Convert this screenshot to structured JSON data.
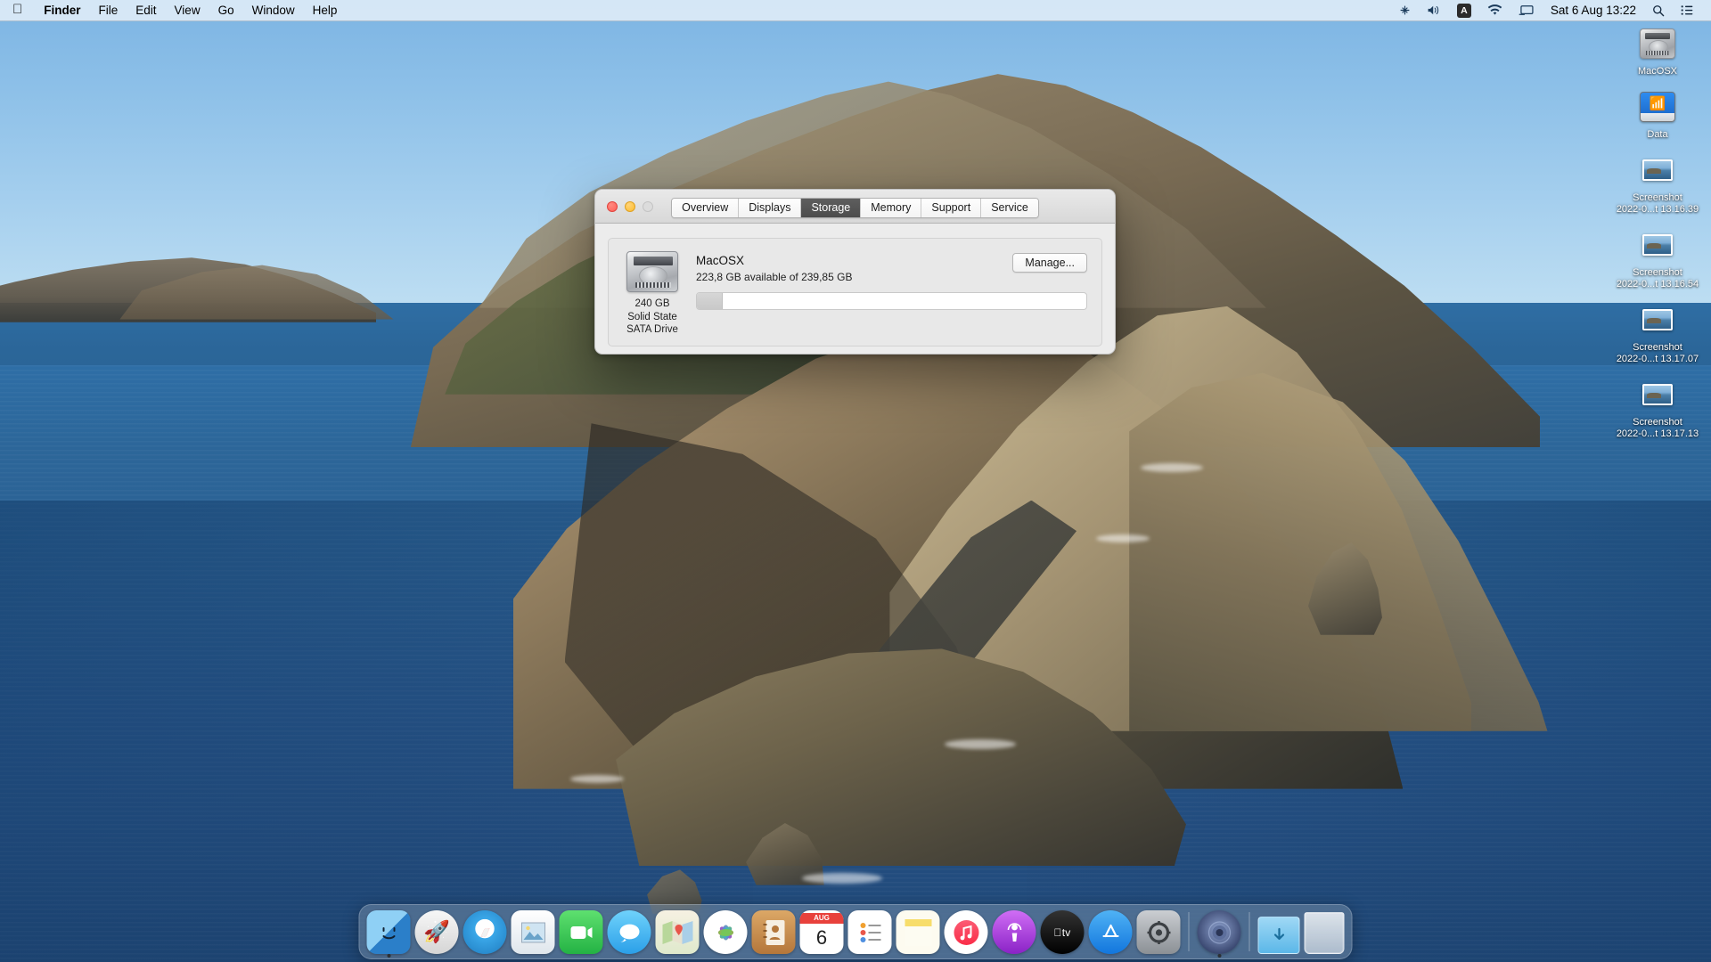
{
  "menubar": {
    "apple_icon": "apple-logo",
    "items": [
      {
        "label": "Finder",
        "bold": true
      },
      {
        "label": "File",
        "bold": false
      },
      {
        "label": "Edit",
        "bold": false
      },
      {
        "label": "View",
        "bold": false
      },
      {
        "label": "Go",
        "bold": false
      },
      {
        "label": "Window",
        "bold": false
      },
      {
        "label": "Help",
        "bold": false
      }
    ],
    "status_icons": [
      {
        "name": "bluetooth-transfer-icon",
        "glyph": "✳"
      },
      {
        "name": "volume-icon",
        "glyph": "🔊"
      },
      {
        "name": "input-source-icon",
        "glyph": "A"
      },
      {
        "name": "wifi-icon",
        "glyph": "wifi"
      },
      {
        "name": "screen-mirroring-icon",
        "glyph": "display"
      }
    ],
    "clock": "Sat 6 Aug 13:22",
    "spotlight_icon": "search-icon",
    "control_center_icon": "control-center-icon"
  },
  "desktop_icons": [
    {
      "name": "MacOSX",
      "type": "hard-drive"
    },
    {
      "name": "Data",
      "type": "network-disk"
    },
    {
      "name": "Screenshot\n2022-0...t 13.16.39",
      "line1": "Screenshot",
      "line2": "2022-0...t 13.16.39",
      "type": "screenshot-file"
    },
    {
      "name": "Screenshot\n2022-0...t 13.16.54",
      "line1": "Screenshot",
      "line2": "2022-0...t 13.16.54",
      "type": "screenshot-file"
    },
    {
      "name": "Screenshot\n2022-0...t 13.17.07",
      "line1": "Screenshot",
      "line2": "2022-0...t 13.17.07",
      "type": "screenshot-file"
    },
    {
      "name": "Screenshot\n2022-0...t 13.17.13",
      "line1": "Screenshot",
      "line2": "2022-0...t 13.17.13",
      "type": "screenshot-file"
    }
  ],
  "about_window": {
    "traffic_lights": {
      "close": "close",
      "minimize": "minimize",
      "zoom": "zoom-disabled"
    },
    "tabs": [
      {
        "label": "Overview",
        "active": false
      },
      {
        "label": "Displays",
        "active": false
      },
      {
        "label": "Storage",
        "active": true
      },
      {
        "label": "Memory",
        "active": false
      },
      {
        "label": "Support",
        "active": false
      },
      {
        "label": "Service",
        "active": false
      }
    ],
    "storage": {
      "volume_name": "MacOSX",
      "availability": "223,8 GB available of 239,85 GB",
      "manage_label": "Manage...",
      "drive_capacity": "240 GB",
      "drive_type_line1": "Solid State",
      "drive_type_line2": "SATA Drive",
      "used_percent": 6.7,
      "used_color": "#cfcfcf",
      "free_color": "#ffffff"
    }
  },
  "dock": {
    "items": [
      {
        "name": "finder",
        "label": "Finder",
        "glyph": "🙂",
        "bg": "linear-gradient(180deg,#4ea8e8,#2a7fc9)",
        "running": true
      },
      {
        "name": "launchpad",
        "label": "Launchpad",
        "glyph": "🚀",
        "bg": "linear-gradient(180deg,#f2f2f2,#d2d2d2)",
        "running": false
      },
      {
        "name": "safari",
        "label": "Safari",
        "glyph": "🧭",
        "bg": "linear-gradient(180deg,#f5fafd,#cfe6f5)",
        "running": false
      },
      {
        "name": "preview",
        "label": "Preview",
        "glyph": "🖼",
        "bg": "linear-gradient(180deg,#ffffff,#e3e8ee)",
        "running": false
      },
      {
        "name": "facetime",
        "label": "FaceTime",
        "glyph": "📹",
        "bg": "linear-gradient(180deg,#4cd964,#2ab24a)",
        "running": false
      },
      {
        "name": "messages",
        "label": "Messages",
        "glyph": "💬",
        "bg": "linear-gradient(180deg,#5ac8fa,#2b9fe8)",
        "running": false
      },
      {
        "name": "maps",
        "label": "Maps",
        "glyph": "🗺",
        "bg": "linear-gradient(180deg,#f7f3e8,#dbe7c8)",
        "running": false
      },
      {
        "name": "photos",
        "label": "Photos",
        "glyph": "🌸",
        "bg": "linear-gradient(180deg,#ffffff,#f0f0f0)",
        "running": false
      },
      {
        "name": "contacts",
        "label": "Contacts",
        "glyph": "📒",
        "bg": "linear-gradient(180deg,#d9a05b,#b4733a)",
        "running": false
      },
      {
        "name": "calendar",
        "label": "Calendar",
        "glyph": "6",
        "bg": "linear-gradient(180deg,#ffffff,#efefef)",
        "running": false
      },
      {
        "name": "reminders",
        "label": "Reminders",
        "glyph": "📋",
        "bg": "linear-gradient(180deg,#ffffff,#f2f2f2)",
        "running": false
      },
      {
        "name": "notes",
        "label": "Notes",
        "glyph": "📝",
        "bg": "linear-gradient(180deg,#fdf3c4,#f7e9a0)",
        "running": false
      },
      {
        "name": "music",
        "label": "Music",
        "glyph": "♪",
        "bg": "linear-gradient(180deg,#ffffff,#ededed)",
        "running": false
      },
      {
        "name": "podcasts",
        "label": "Podcasts",
        "glyph": "🎙",
        "bg": "linear-gradient(180deg,#c55cf0,#8d27c9)",
        "running": false
      },
      {
        "name": "apple-tv",
        "label": "TV",
        "glyph": "tv",
        "bg": "linear-gradient(180deg,#2b2b2b,#0d0d0d)",
        "running": false
      },
      {
        "name": "app-store",
        "label": "App Store",
        "glyph": "A",
        "bg": "linear-gradient(180deg,#4aa8f0,#1f7fd8)",
        "running": false
      },
      {
        "name": "system-preferences",
        "label": "System Preferences",
        "glyph": "⚙",
        "bg": "linear-gradient(180deg,#c9ccd0,#8d9196)",
        "running": false
      }
    ],
    "right_items": [
      {
        "name": "system-information",
        "label": "System Information",
        "glyph": "◉",
        "bg": "linear-gradient(180deg,#6f7ea8,#3e4a6e)",
        "running": true
      }
    ],
    "downloads": {
      "name": "downloads-folder",
      "label": "Downloads",
      "glyph": "↓"
    },
    "trash": {
      "name": "trash",
      "label": "Trash"
    }
  }
}
